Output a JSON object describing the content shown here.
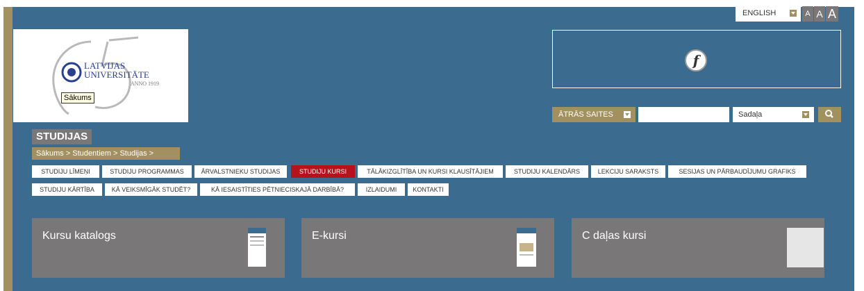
{
  "header": {
    "language_label": "ENGLISH",
    "font_sizes": [
      "A",
      "A",
      "A"
    ],
    "logo_tooltip": "Sākums",
    "logo_text": [
      "LATVIJAS",
      "UNIVERSITĀTE",
      "ANNO 1919"
    ],
    "quick_links_label": "ĀTRĀS SAITES",
    "search_placeholder": "",
    "section_select_value": "Sadaļa"
  },
  "page": {
    "title": "STUDIJAS",
    "breadcrumb": "Sākums  >  Studentiem  >  Studijas  >"
  },
  "nav": {
    "row1": [
      {
        "label": "STUDIJU LĪMEŅI",
        "active": false
      },
      {
        "label": "STUDIJU PROGRAMMAS",
        "active": false
      },
      {
        "label": "ĀRVALSTNIEKU STUDIJAS",
        "active": false
      },
      {
        "label": "STUDIJU KURSI",
        "active": true
      },
      {
        "label": "TĀLĀKIZGLĪTĪBA UN KURSI KLAUSĪTĀJIEM",
        "active": false
      },
      {
        "label": "STUDIJU KALENDĀRS",
        "active": false
      },
      {
        "label": "LEKCIJU SARAKSTS",
        "active": false
      },
      {
        "label": "SESIJAS UN PĀRBAUDĪJUMU GRAFIKS",
        "active": false
      }
    ],
    "row2": [
      {
        "label": "STUDIJU KĀRTĪBA",
        "active": false
      },
      {
        "label": "KĀ VEIKSMĪGĀK STUDĒT?",
        "active": false
      },
      {
        "label": "KĀ IESAISTĪTIES PĒTNIECISKAJĀ DARBĪBĀ?",
        "active": false
      },
      {
        "label": "IZLAIDUMI",
        "active": false
      },
      {
        "label": "KONTAKTI",
        "active": false
      }
    ]
  },
  "cards": [
    {
      "title": "Kursu katalogs"
    },
    {
      "title": "E-kursi"
    },
    {
      "title": "C daļas kursi"
    }
  ],
  "colors": {
    "background": "#3b6b8e",
    "accent_gold": "#a39061",
    "grey": "#7a7778",
    "active_red": "#b5121b"
  }
}
